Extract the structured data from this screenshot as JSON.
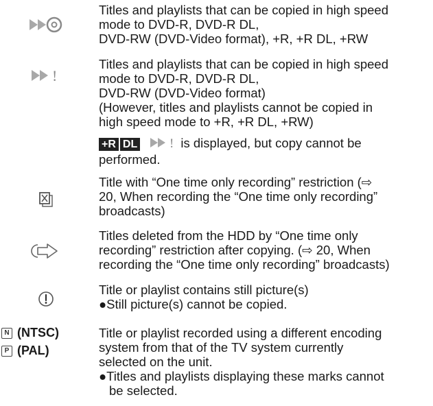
{
  "rows": [
    {
      "icon": "high-speed-copy-disc-icon",
      "lines": [
        "Titles and playlists that can be copied in high speed",
        "mode to DVD-R, DVD-R DL,",
        "DVD-RW (DVD-Video format), +R, +R DL, +RW"
      ]
    },
    {
      "icon": "high-speed-copy-limited-icon",
      "lines": [
        "Titles and playlists that can be copied in high speed",
        "mode to DVD-R, DVD-R DL,",
        "DVD-RW (DVD-Video format)",
        "(However, titles and playlists cannot be copied in",
        "high speed mode to +R, +R DL, +RW)"
      ],
      "note": {
        "badge_a": "+R",
        "badge_b": "DL",
        "line1": "is displayed, but copy cannot be",
        "line2": "performed."
      }
    },
    {
      "icon": "one-time-recording-icon",
      "lines": [
        "Title with “One time only recording” restriction (⇨",
        "20, When recording the “One time only recording”",
        "broadcasts)"
      ]
    },
    {
      "icon": "deleted-after-copy-icon",
      "lines": [
        "Titles deleted from the HDD by “One time only",
        "recording” restriction after copying. (⇨ 20, When",
        "recording the “One time only recording” broadcasts)"
      ]
    },
    {
      "icon": "still-picture-icon",
      "lines": [
        "Title or playlist contains still picture(s)"
      ],
      "bullets": [
        {
          "line1": "●Still picture(s) cannot be copied.",
          "line2": ""
        }
      ]
    },
    {
      "icon": "encoding-system-icon",
      "marks": [
        {
          "letter": "N",
          "label": "(NTSC)"
        },
        {
          "letter": "P",
          "label": "(PAL)"
        }
      ],
      "lines": [
        "Title or playlist recorded using a different encoding",
        "system from that of the TV system currently",
        "selected on the unit."
      ],
      "bullets": [
        {
          "line1": "●Titles and playlists displaying these marks cannot",
          "line2": "be selected."
        }
      ]
    }
  ],
  "colors": {
    "icon_gray": "#9a9a9a",
    "text": "#1a1a1a",
    "badge_bg": "#222222"
  }
}
